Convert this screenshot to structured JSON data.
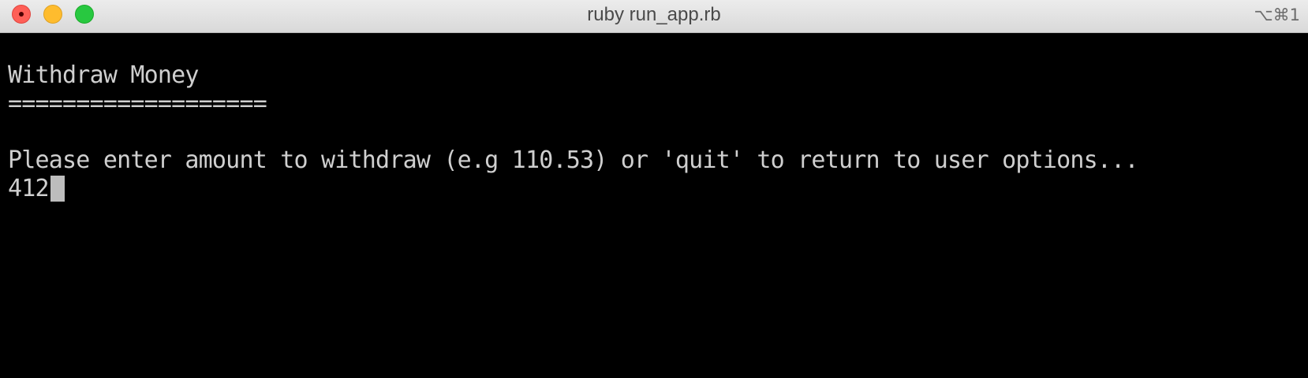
{
  "window": {
    "title": "ruby run_app.rb",
    "shortcut": "⌥⌘1"
  },
  "terminal": {
    "heading": "Withdraw Money",
    "underline": "===================",
    "prompt": "Please enter amount to withdraw (e.g 110.53) or 'quit' to return to user options...",
    "input": "412"
  },
  "icons": {
    "close": "close-button-icon",
    "minimize": "minimize-button-icon",
    "zoom": "zoom-button-icon",
    "cursor": "text-cursor-block"
  },
  "colors": {
    "background": "#000000",
    "text": "#cfcfcf",
    "cursor": "#bdbdbd",
    "close": "#fe5f57",
    "minimize": "#febc2e",
    "zoom": "#28c840"
  }
}
